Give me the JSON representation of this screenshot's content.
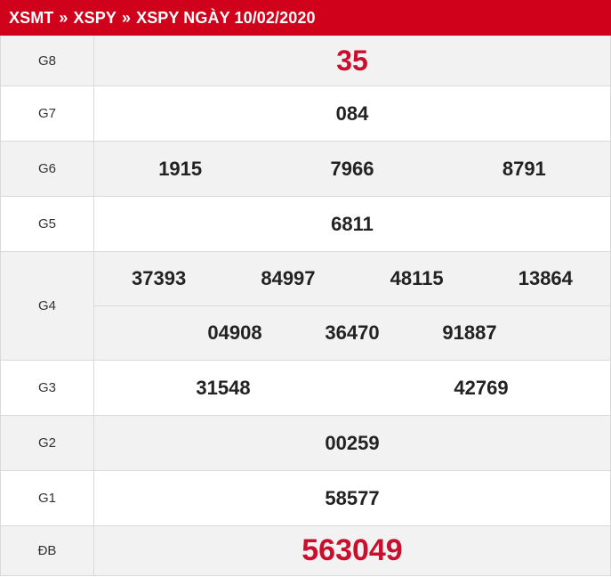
{
  "breadcrumb": {
    "items": [
      "XSMT",
      "XSPY",
      "XSPY NGÀY 10/02/2020"
    ],
    "separator": "»"
  },
  "results": {
    "g8": {
      "label": "G8",
      "numbers": [
        "35"
      ]
    },
    "g7": {
      "label": "G7",
      "numbers": [
        "084"
      ]
    },
    "g6": {
      "label": "G6",
      "numbers": [
        "1915",
        "7966",
        "8791"
      ]
    },
    "g5": {
      "label": "G5",
      "numbers": [
        "6811"
      ]
    },
    "g4": {
      "label": "G4",
      "numbers": [
        "37393",
        "84997",
        "48115",
        "13864",
        "04908",
        "36470",
        "91887"
      ]
    },
    "g3": {
      "label": "G3",
      "numbers": [
        "31548",
        "42769"
      ]
    },
    "g2": {
      "label": "G2",
      "numbers": [
        "00259"
      ]
    },
    "g1": {
      "label": "G1",
      "numbers": [
        "58577"
      ]
    },
    "db": {
      "label": "ĐB",
      "numbers": [
        "563049"
      ]
    }
  },
  "colors": {
    "header_bg": "#d0021b",
    "highlight_red": "#c8102e",
    "row_gray": "#f2f2f2",
    "border": "#d9d9d9"
  }
}
